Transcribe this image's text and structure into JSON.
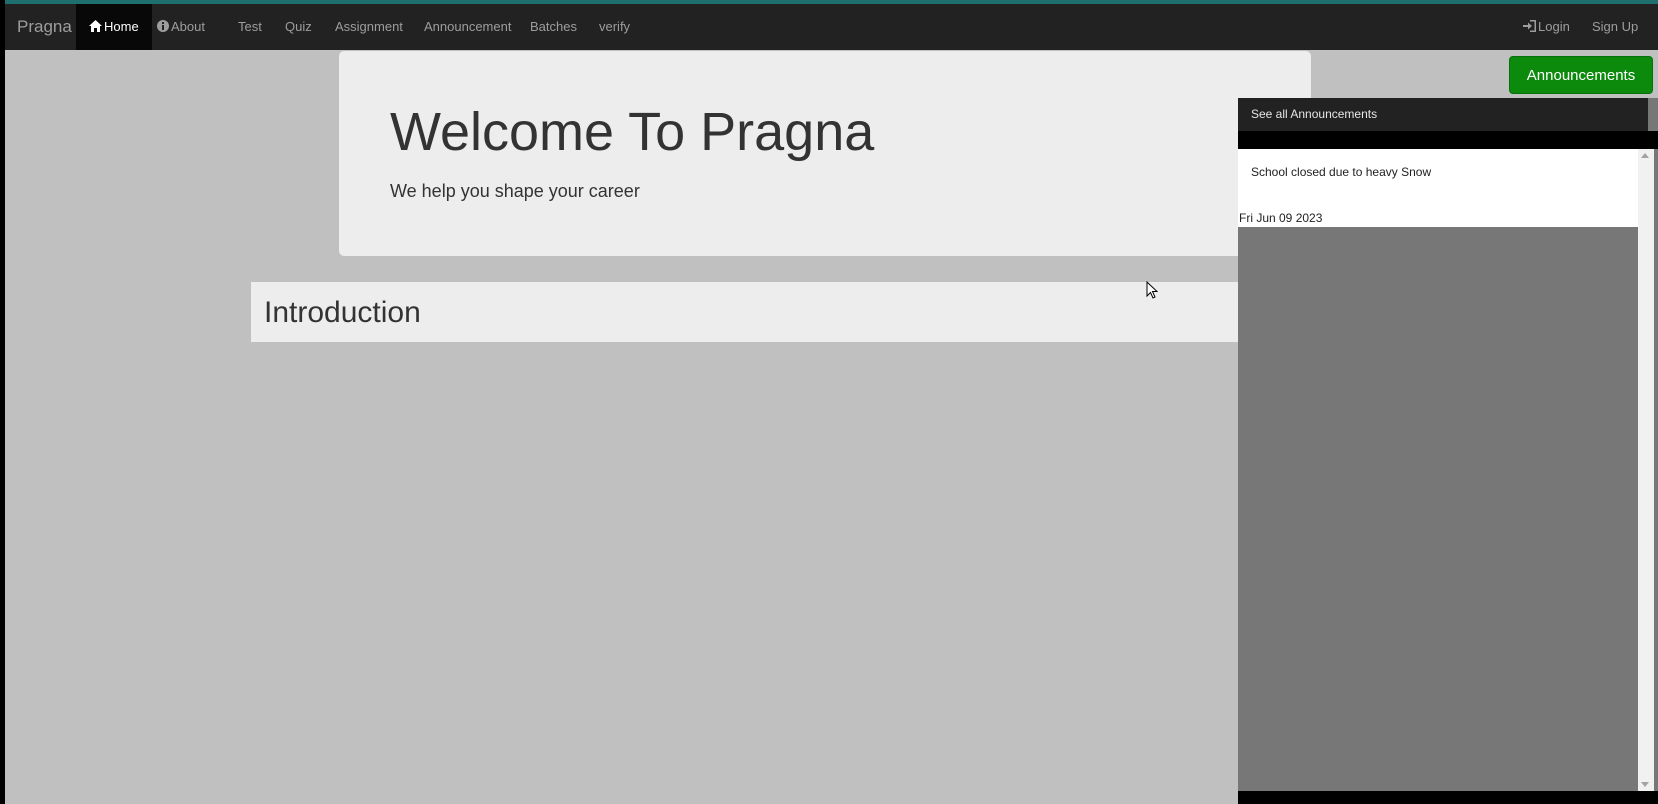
{
  "navbar": {
    "brand": "Pragna",
    "items": [
      {
        "label": "Home",
        "icon": "home-icon",
        "active": true
      },
      {
        "label": "About",
        "icon": "info-icon"
      },
      {
        "label": "Test"
      },
      {
        "label": "Quiz"
      },
      {
        "label": "Assignment"
      },
      {
        "label": "Announcement"
      },
      {
        "label": "Batches"
      },
      {
        "label": "verify"
      }
    ],
    "right": [
      {
        "label": "Login",
        "icon": "login-icon"
      },
      {
        "label": "Sign Up"
      }
    ]
  },
  "jumbotron": {
    "title": "Welcome To Pragna",
    "subtitle": "We help you shape your career"
  },
  "intro": {
    "title": "Introduction"
  },
  "announcements": {
    "button_label": "Announcements",
    "header_label": "See all Announcements",
    "items": [
      {
        "text": "School closed due to heavy Snow",
        "date": "Fri Jun 09 2023"
      }
    ]
  },
  "colors": {
    "navbar_bg": "#222222",
    "announcement_button": "#0b8a0b",
    "page_bg": "#c0c0c0"
  }
}
